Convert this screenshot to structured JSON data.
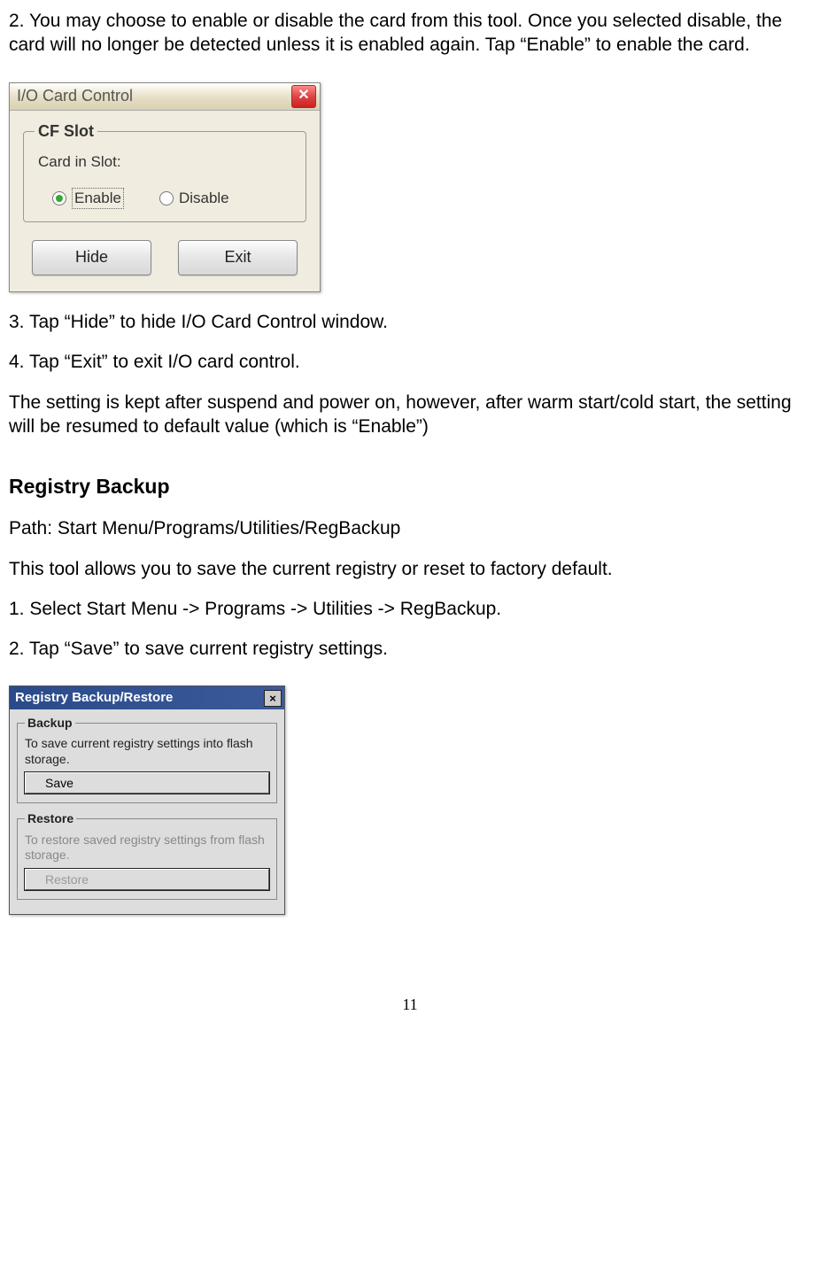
{
  "body": {
    "step2": "2. You may choose to enable or disable the card from this tool. Once you selected disable, the card will no longer be detected unless it is enabled again. Tap “Enable” to enable the card.",
    "step3": "3. Tap “Hide” to hide I/O Card Control window.",
    "step4": "4. Tap “Exit” to exit I/O card control.",
    "note": "The setting is kept after suspend and power on, however, after warm start/cold start, the setting will be resumed to default value (which is “Enable”)",
    "reg_heading": "Registry Backup",
    "reg_path": "Path: Start Menu/Programs/Utilities/RegBackup",
    "reg_desc": "This tool allows you to save the current registry or reset to factory default.",
    "reg_step1": "1. Select Start Menu -> Programs -> Utilities -> RegBackup.",
    "reg_step2": "2. Tap “Save” to save current registry settings."
  },
  "io_window": {
    "title": "I/O Card Control",
    "cf_slot": "CF Slot",
    "card_label": "Card in Slot:",
    "enable": "Enable",
    "disable": "Disable",
    "hide": "Hide",
    "exit": "Exit"
  },
  "reg_window": {
    "title": "Registry Backup/Restore",
    "backup_legend": "Backup",
    "backup_text": "To save current registry settings into flash storage.",
    "save_btn": "Save",
    "restore_legend": "Restore",
    "restore_text": "To restore saved registry settings from flash storage.",
    "restore_btn": "Restore"
  },
  "pagenum": "11"
}
